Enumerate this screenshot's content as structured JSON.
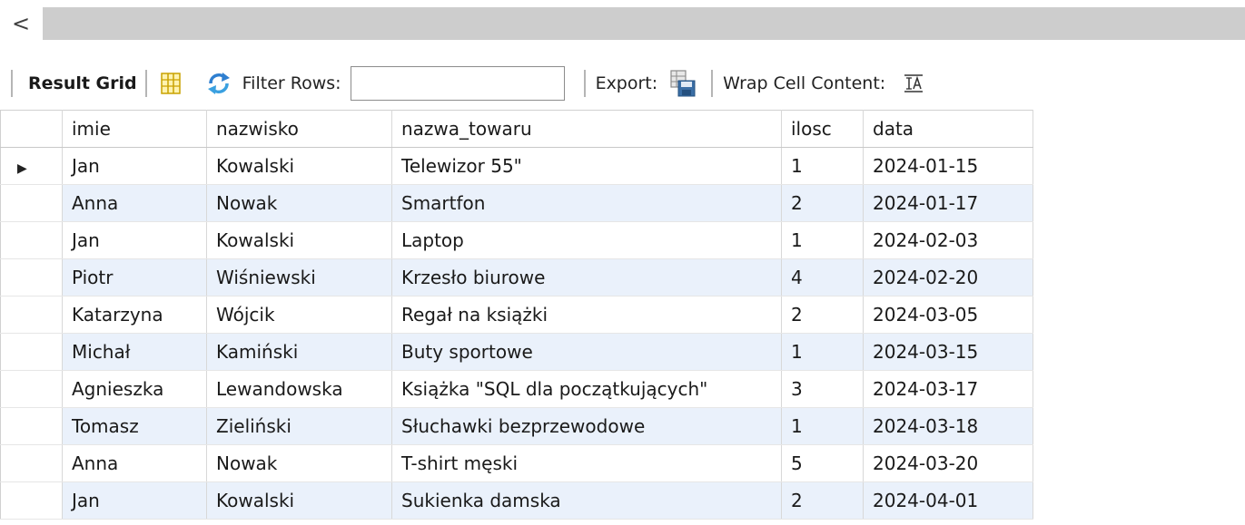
{
  "scrollbar": {
    "left_arrow": "<"
  },
  "toolbar": {
    "result_grid": "Result Grid",
    "filter_rows": "Filter Rows:",
    "filter_value": "",
    "export": "Export:",
    "wrap_cell_content": "Wrap Cell Content:"
  },
  "columns": [
    "imie",
    "nazwisko",
    "nazwa_towaru",
    "ilosc",
    "data"
  ],
  "rows": [
    [
      "Jan",
      "Kowalski",
      "Telewizor 55\"",
      "1",
      "2024-01-15"
    ],
    [
      "Anna",
      "Nowak",
      "Smartfon",
      "2",
      "2024-01-17"
    ],
    [
      "Jan",
      "Kowalski",
      "Laptop",
      "1",
      "2024-02-03"
    ],
    [
      "Piotr",
      "Wiśniewski",
      "Krzesło biurowe",
      "4",
      "2024-02-20"
    ],
    [
      "Katarzyna",
      "Wójcik",
      "Regał na książki",
      "2",
      "2024-03-05"
    ],
    [
      "Michał",
      "Kamiński",
      "Buty sportowe",
      "1",
      "2024-03-15"
    ],
    [
      "Agnieszka",
      "Lewandowska",
      "Książka \"SQL dla początkujących\"",
      "3",
      "2024-03-17"
    ],
    [
      "Tomasz",
      "Zieliński",
      "Słuchawki bezprzewodowe",
      "1",
      "2024-03-18"
    ],
    [
      "Anna",
      "Nowak",
      "T-shirt męski",
      "5",
      "2024-03-20"
    ],
    [
      "Jan",
      "Kowalski",
      "Sukienka damska",
      "2",
      "2024-04-01"
    ]
  ],
  "icons": {
    "grid": "grid-icon",
    "refresh": "refresh-icon",
    "export": "export-icon",
    "wrap": "wrap-cell-icon",
    "current_row": "row-pointer-icon"
  }
}
